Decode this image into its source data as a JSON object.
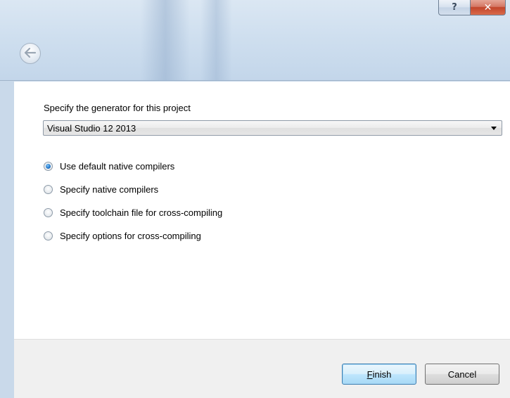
{
  "window": {
    "help_button": "?",
    "close_button": "✕"
  },
  "generator": {
    "label": "Specify the generator for this project",
    "selected": "Visual Studio 12 2013"
  },
  "compiler_options": [
    {
      "label": "Use default native compilers",
      "checked": true
    },
    {
      "label": "Specify native compilers",
      "checked": false
    },
    {
      "label": "Specify toolchain file for cross-compiling",
      "checked": false
    },
    {
      "label": "Specify options for cross-compiling",
      "checked": false
    }
  ],
  "buttons": {
    "finish_mnemonic": "F",
    "finish_rest": "inish",
    "cancel": "Cancel"
  },
  "icons": {
    "back": "back-arrow-icon",
    "dropdown": "chevron-down-icon"
  }
}
